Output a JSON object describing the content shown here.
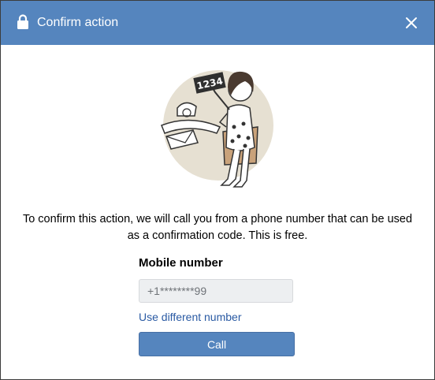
{
  "dialog": {
    "title": "Confirm action",
    "message": "To confirm this action, we will call you from a phone number that can be used as a confirmation code. This is free.",
    "field_label": "Mobile number",
    "phone_value": "+1********99",
    "link_label": "Use different number",
    "button_label": "Call"
  },
  "illustration": {
    "sign_text": "1234"
  },
  "icons": {
    "title": "lock-icon",
    "close": "close-icon"
  },
  "colors": {
    "titlebar": "#5585be",
    "button": "#5585be",
    "link": "#2a5aa3",
    "input_bg": "#edeff1"
  }
}
